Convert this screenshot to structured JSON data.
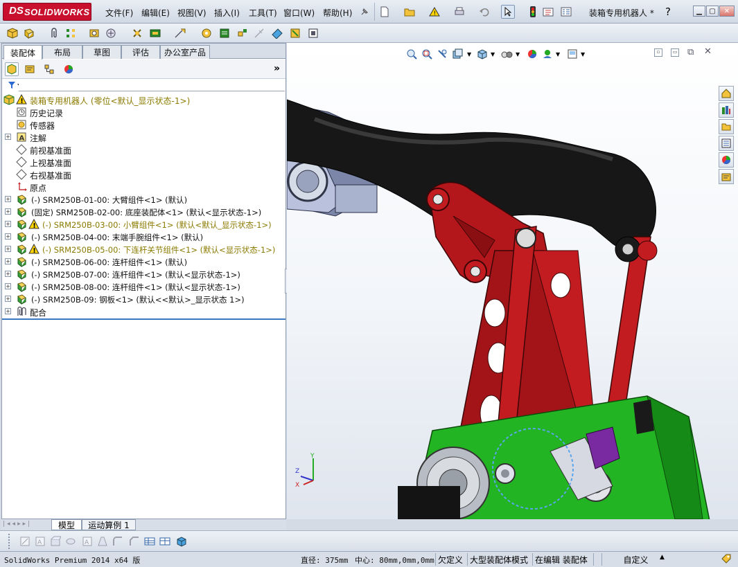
{
  "app": {
    "brand_ds": "DS",
    "brand": "SOLIDWORKS"
  },
  "menu": [
    "文件(F)",
    "编辑(E)",
    "视图(V)",
    "插入(I)",
    "工具(T)",
    "窗口(W)",
    "帮助(H)"
  ],
  "window": {
    "doc_title": "装箱专用机器人 *",
    "help": "?"
  },
  "tabs": [
    "装配体",
    "布局",
    "草图",
    "评估",
    "办公室产品"
  ],
  "active_tab": 0,
  "tree": {
    "root": "装箱专用机器人  (零位<默认_显示状态-1>)",
    "features": [
      "历史记录",
      "传感器",
      "注解",
      "前视基准面",
      "上视基准面",
      "右视基准面",
      "原点"
    ],
    "components": [
      {
        "label": "(-) SRM250B-01-00: 大臂组件<1> (默认)",
        "warn": false
      },
      {
        "label": "(固定) SRM250B-02-00: 底座装配体<1> (默认<显示状态-1>)",
        "warn": false
      },
      {
        "label": "(-) SRM250B-03-00: 小臂组件<1> (默认<默认_显示状态-1>)",
        "warn": true
      },
      {
        "label": "(-) SRM250B-04-00: 末端手腕组件<1> (默认)",
        "warn": false
      },
      {
        "label": "(-) SRM250B-05-00: 下连杆关节组件<1> (默认<显示状态-1>)",
        "warn": true
      },
      {
        "label": "(-) SRM250B-06-00: 连杆组件<1> (默认)",
        "warn": false
      },
      {
        "label": "(-) SRM250B-07-00: 连杆组件<1> (默认<显示状态-1>)",
        "warn": false
      },
      {
        "label": "(-) SRM250B-08-00: 连杆组件<1> (默认<显示状态-1>)",
        "warn": false
      },
      {
        "label": "(-) SRM250B-09: 钢板<1> (默认<<默认>_显示状态 1>)",
        "warn": false
      }
    ],
    "mates": "配合"
  },
  "bottom_tabs": [
    "模型",
    "运动算例 1"
  ],
  "status": {
    "product": "SolidWorks Premium 2014 x64 版",
    "diameter": "直径: 375mm",
    "center": "中心: 80mm,0mm,0mm",
    "underdefined": "欠定义",
    "large_assembly": "大型装配体模式",
    "editing": "在编辑 装配体",
    "custom": "自定义"
  },
  "triad": {
    "y": "Y",
    "z": "Z",
    "x": "X"
  },
  "colors": {
    "brand": "#c8102e",
    "arm_black": "#1a1a1a",
    "arm_red": "#b3171b",
    "base_green": "#22b422",
    "highlight": "#3a78c4",
    "warn_text": "#8b7a00"
  }
}
